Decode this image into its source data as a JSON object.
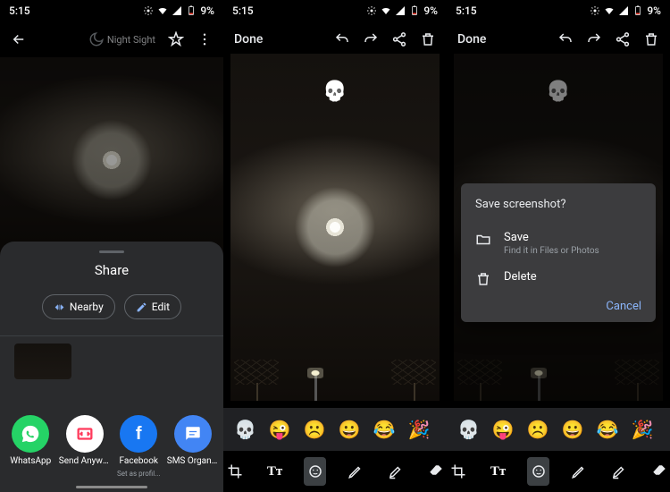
{
  "status": {
    "time": "5:15",
    "battery": "9%"
  },
  "panel1": {
    "night_sight": "Night Sight",
    "share_title": "Share",
    "nearby_label": "Nearby",
    "edit_label": "Edit",
    "apps": [
      {
        "label": "WhatsApp",
        "sub": "",
        "bg": "#25D366"
      },
      {
        "label": "Send Anywh...",
        "sub": "",
        "bg": "#ffffff"
      },
      {
        "label": "Facebook",
        "sub": "Set as profil...",
        "bg": "#1877F2"
      },
      {
        "label": "SMS Organi...",
        "sub": "",
        "bg": "#4285F4"
      }
    ]
  },
  "editor": {
    "done": "Done",
    "emojis": [
      "💀",
      "😜",
      "☹️",
      "😀",
      "😂",
      "🎉"
    ]
  },
  "dialog": {
    "title": "Save screenshot?",
    "save_label": "Save",
    "save_sub": "Find it in Files or Photos",
    "delete_label": "Delete",
    "cancel_label": "Cancel"
  },
  "tools": {
    "crop": "crop",
    "text": "Tт",
    "sticker": "sticker",
    "draw": "draw",
    "highlight": "highlight",
    "erase": "erase"
  }
}
